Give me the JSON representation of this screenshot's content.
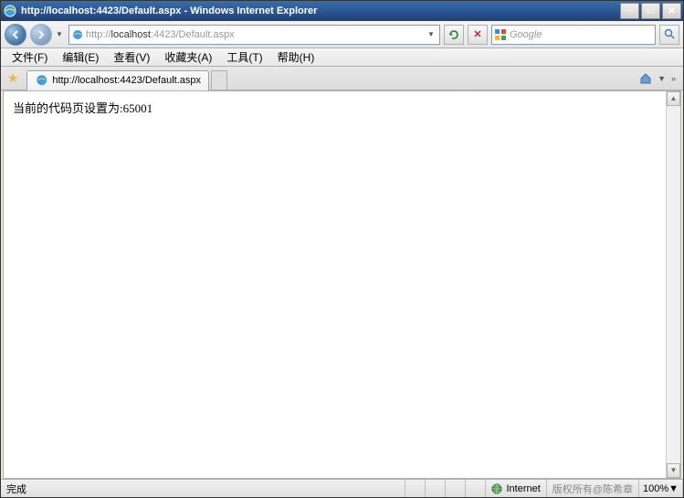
{
  "window": {
    "title": "http://localhost:4423/Default.aspx - Windows Internet Explorer"
  },
  "nav": {
    "url_prefix": "http://",
    "url_host": "localhost",
    "url_suffix": ":4423/Default.aspx"
  },
  "search": {
    "provider": "Google"
  },
  "menu": {
    "file": "文件(F)",
    "edit": "编辑(E)",
    "view": "查看(V)",
    "favorites": "收藏夹(A)",
    "tools": "工具(T)",
    "help": "帮助(H)"
  },
  "tab": {
    "title": "http://localhost:4423/Default.aspx"
  },
  "page": {
    "body_text": "当前的代码页设置为:65001"
  },
  "status": {
    "done": "完成",
    "zone": "Internet",
    "zoom": "100%",
    "watermark": "版权所有@陈希章"
  }
}
